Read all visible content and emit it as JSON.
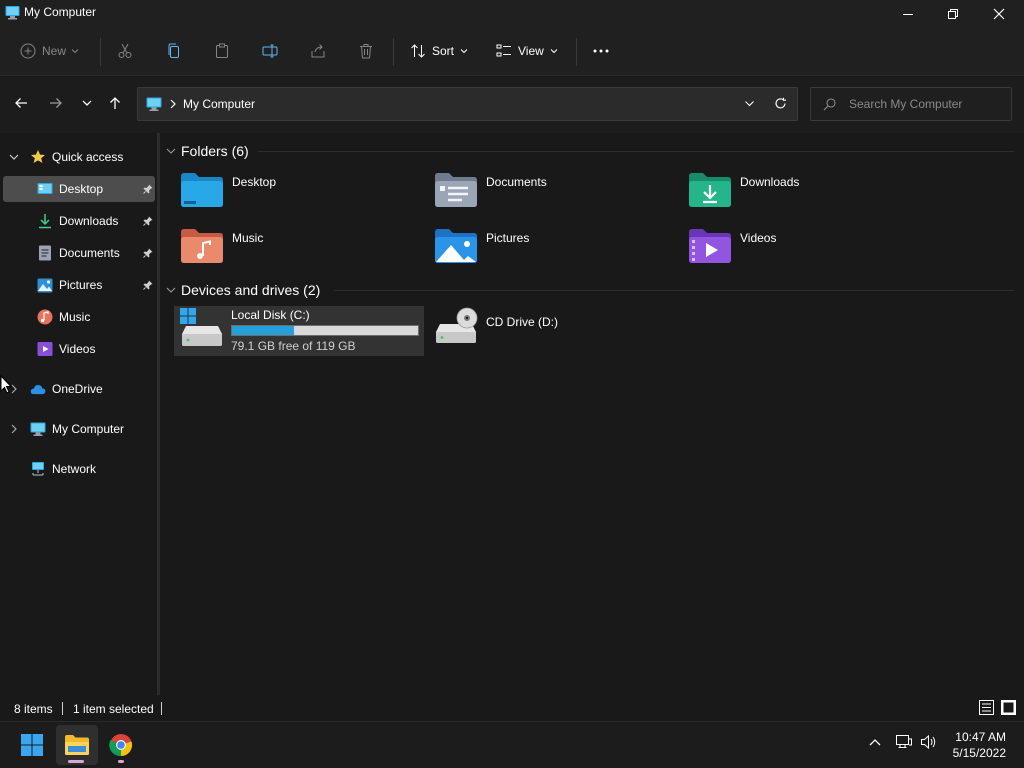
{
  "window": {
    "title": "My Computer"
  },
  "toolbar": {
    "new_label": "New",
    "sort_label": "Sort",
    "view_label": "View"
  },
  "address": {
    "path": "My Computer",
    "search_placeholder": "Search My Computer"
  },
  "sidebar": {
    "quick_access": "Quick access",
    "items": [
      {
        "label": "Desktop",
        "pinned": true,
        "selected": true
      },
      {
        "label": "Downloads",
        "pinned": true
      },
      {
        "label": "Documents",
        "pinned": true
      },
      {
        "label": "Pictures",
        "pinned": true
      },
      {
        "label": "Music"
      },
      {
        "label": "Videos"
      }
    ],
    "onedrive": "OneDrive",
    "my_computer": "My Computer",
    "network": "Network"
  },
  "main": {
    "folders_header": "Folders (6)",
    "folders": [
      {
        "label": "Desktop",
        "icon": "desktop-folder-icon"
      },
      {
        "label": "Documents",
        "icon": "documents-folder-icon"
      },
      {
        "label": "Downloads",
        "icon": "downloads-folder-icon"
      },
      {
        "label": "Music",
        "icon": "music-folder-icon"
      },
      {
        "label": "Pictures",
        "icon": "pictures-folder-icon"
      },
      {
        "label": "Videos",
        "icon": "videos-folder-icon"
      }
    ],
    "devices_header": "Devices and drives (2)",
    "drives": [
      {
        "label": "Local Disk (C:)",
        "free_text": "79.1 GB free of 119 GB",
        "used_fraction": 0.335
      },
      {
        "label": "CD Drive (D:)"
      }
    ]
  },
  "statusbar": {
    "items_count": "8 items",
    "selected": "1 item selected"
  },
  "taskbar": {
    "time": "10:47 AM",
    "date": "5/15/2022"
  },
  "colors": {
    "accent": "#26a0da",
    "background": "#191919",
    "chrome": "#202020",
    "selection": "#4d4d4d"
  }
}
